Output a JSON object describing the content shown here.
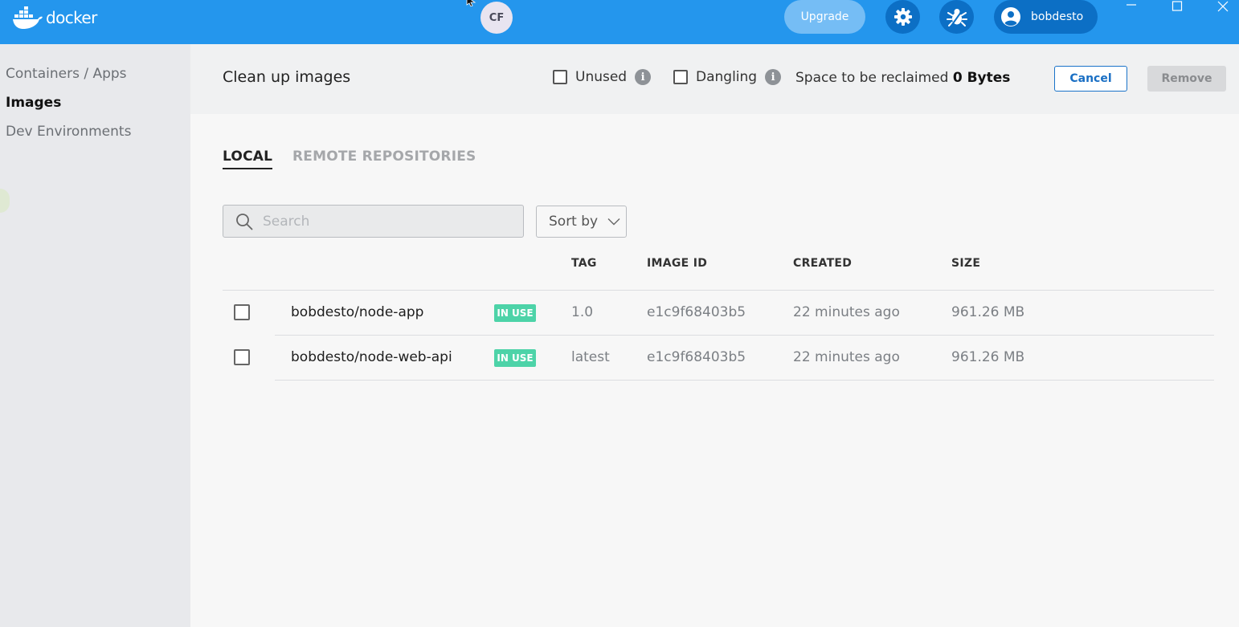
{
  "app": {
    "logo_text": "docker",
    "presence_avatar": "CF",
    "upgrade_label": "Upgrade",
    "user_name": "bobdesto",
    "brand_color": "#2496ed"
  },
  "sidebar": {
    "items": [
      {
        "label": "Containers / Apps",
        "active": false
      },
      {
        "label": "Images",
        "active": true
      },
      {
        "label": "Dev Environments",
        "active": false
      }
    ]
  },
  "cleanup": {
    "title": "Clean up images",
    "unused_label": "Unused",
    "dangling_label": "Dangling",
    "info_glyph": "i",
    "reclaim_prefix": "Space to be reclaimed",
    "reclaim_value": "0 Bytes",
    "cancel_label": "Cancel",
    "remove_label": "Remove"
  },
  "tabs": [
    {
      "label": "LOCAL",
      "active": true
    },
    {
      "label": "REMOTE REPOSITORIES",
      "active": false
    }
  ],
  "search": {
    "placeholder": "Search",
    "value": ""
  },
  "sort": {
    "label": "Sort by"
  },
  "table": {
    "columns": [
      "TAG",
      "IMAGE ID",
      "CREATED",
      "SIZE"
    ],
    "rows": [
      {
        "name": "bobdesto/node-app",
        "badge": "IN USE",
        "tag": "1.0",
        "image_id": "e1c9f68403b5",
        "created": "22 minutes ago",
        "size": "961.26 MB"
      },
      {
        "name": "bobdesto/node-web-api",
        "badge": "IN USE",
        "tag": "latest",
        "image_id": "e1c9f68403b5",
        "created": "22 minutes ago",
        "size": "961.26 MB"
      }
    ]
  }
}
